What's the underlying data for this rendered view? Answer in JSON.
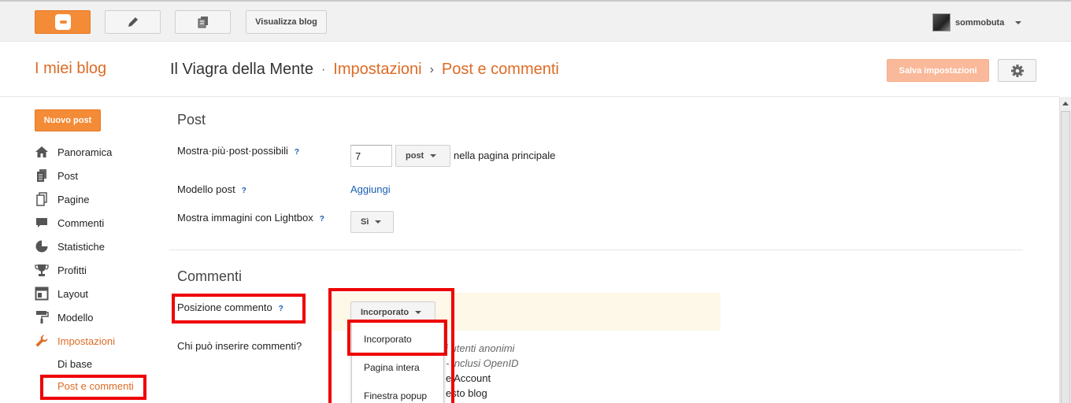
{
  "topbar": {
    "logo_icon": "blogger-icon",
    "new_post_icon": "pencil-icon",
    "pages_icon": "pages-icon",
    "view_blog_label": "Visualizza blog",
    "username": "sommobuta"
  },
  "header": {
    "my_blogs": "I miei blog",
    "blog_name": "Il Viagra della Mente",
    "sep1": "·",
    "section": "Impostazioni",
    "sep2": "›",
    "page": "Post e commenti",
    "save_label": "Salva impostazioni"
  },
  "sidebar": {
    "new_post_label": "Nuovo post",
    "items": [
      {
        "label": "Panoramica",
        "icon": "home-icon"
      },
      {
        "label": "Post",
        "icon": "posts-icon"
      },
      {
        "label": "Pagine",
        "icon": "pages-icon"
      },
      {
        "label": "Commenti",
        "icon": "comments-icon"
      },
      {
        "label": "Statistiche",
        "icon": "stats-icon"
      },
      {
        "label": "Profitti",
        "icon": "trophy-icon"
      },
      {
        "label": "Layout",
        "icon": "layout-icon"
      },
      {
        "label": "Modello",
        "icon": "paint-roller-icon"
      },
      {
        "label": "Impostazioni",
        "icon": "wrench-icon"
      }
    ],
    "sub_items": [
      "Di base",
      "Post e commenti"
    ]
  },
  "post_section": {
    "title": "Post",
    "show_max_label": "Mostra·più·post·possibili",
    "show_max_value": "7",
    "show_max_unit": "post",
    "show_max_suffix": "nella pagina principale",
    "template_label": "Modello post",
    "template_link": "Aggiungi",
    "lightbox_label": "Mostra immagini con Lightbox",
    "lightbox_value": "Sì",
    "help": "?"
  },
  "comments_section": {
    "title": "Commenti",
    "position_label": "Posizione commento",
    "position_value": "Incorporato",
    "who_label": "Chi può inserire commenti?",
    "who_options_partial": [
      "i utenti anonimi",
      "- inclusi OpenID",
      "e Account",
      "esto blog"
    ],
    "dropdown_options": [
      "Incorporato",
      "Pagina intera",
      "Finestra popup"
    ]
  }
}
